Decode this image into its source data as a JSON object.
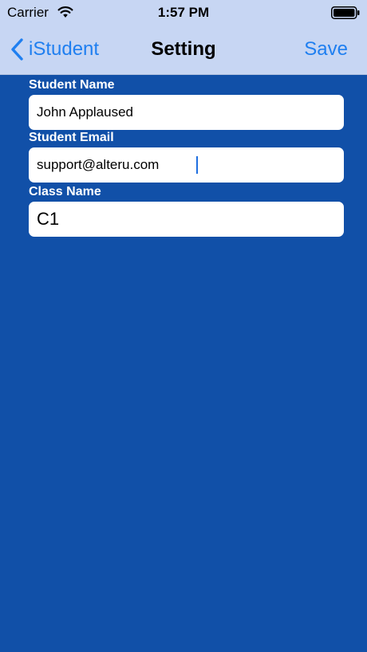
{
  "status_bar": {
    "carrier": "Carrier",
    "time": "1:57 PM",
    "wifi_icon": "wifi-icon",
    "battery_icon": "battery-icon"
  },
  "nav": {
    "back_label": "iStudent",
    "back_icon": "chevron-left-icon",
    "title": "Setting",
    "save_label": "Save"
  },
  "form": {
    "student_name": {
      "label": "Student Name",
      "value": "John Applaused"
    },
    "student_email": {
      "label": "Student Email",
      "value": "support@alteru.com"
    },
    "class_name": {
      "label": "Class Name",
      "value": "C1"
    }
  },
  "colors": {
    "background": "#1150a8",
    "top_bar": "#c7d6f3",
    "accent": "#1f7ff0"
  }
}
